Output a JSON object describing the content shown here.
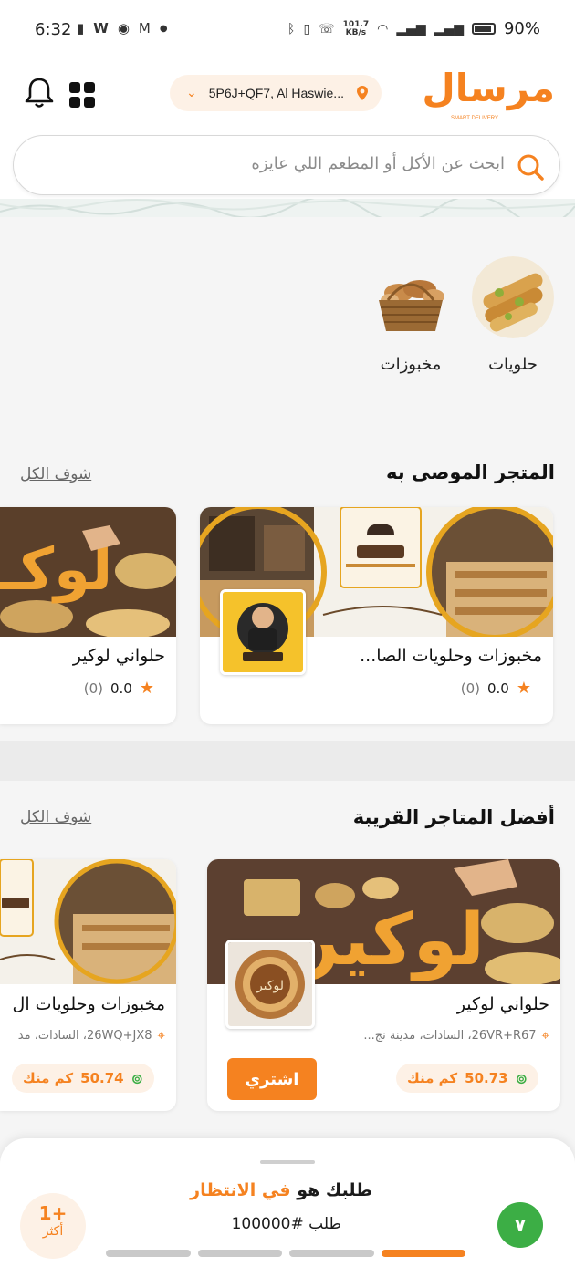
{
  "status_bar": {
    "time": "6:32",
    "speed_value": "101.7",
    "speed_unit": "KB/s",
    "battery": "90%"
  },
  "header": {
    "location": "5P6J+QF7, Al Haswie...",
    "logo_text": "مرسال",
    "logo_subtitle": "SMART DELIVERY"
  },
  "search": {
    "placeholder": "ابحث عن الأكل أو المطعم اللي عايزه"
  },
  "categories": [
    {
      "label": "حلويات",
      "icon": "sweets-image"
    },
    {
      "label": "مخبوزات",
      "icon": "bread-basket-image"
    }
  ],
  "recommended": {
    "title": "المتجر الموصى به",
    "see_all": "شوف الكل",
    "stores": [
      {
        "name": "مخبوزات وحلويات الصا...",
        "rating": "0.0",
        "count": "(0)"
      },
      {
        "name": "حلواني لوكير",
        "rating": "0.0",
        "count": "(0)"
      }
    ]
  },
  "nearby": {
    "title": "أفضل المتاجر القريبة",
    "see_all": "شوف الكل",
    "stores": [
      {
        "name": "حلواني لوكير",
        "address": "26VR+R67، السادات، مدينة نج...",
        "distance": "50.73",
        "unit": "كم منك",
        "buy_label": "اشتري"
      },
      {
        "name": "مخبوزات وحلويات ال",
        "address": "26WQ+JX8، السادات، مد",
        "distance": "50.74",
        "unit": "كم منك"
      }
    ]
  },
  "order": {
    "more_count": "1+",
    "more_label": "أكثر",
    "status_prefix": "طلبك هو ",
    "status_highlight": "في الانتظار",
    "order_number": "طلب #100000",
    "step": "٧",
    "progress_steps": 4,
    "progress_active": 4
  },
  "colors": {
    "accent": "#f58220",
    "green": "#3cae45"
  }
}
